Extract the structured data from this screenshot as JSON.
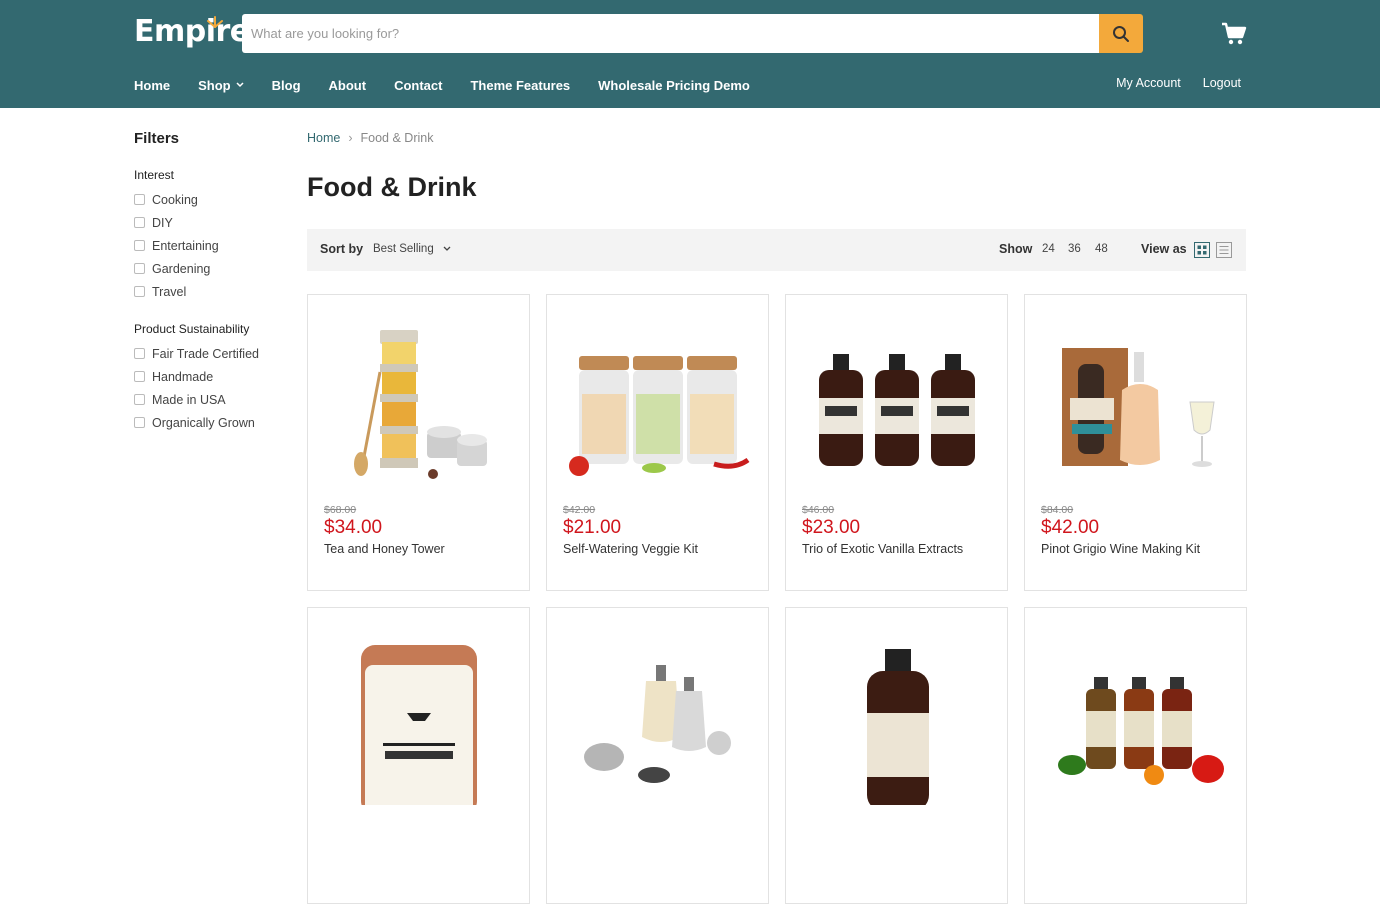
{
  "header": {
    "logo": "Empire",
    "search_placeholder": "What are you looking for?",
    "colors": {
      "bar": "#336970",
      "search_button": "#f3a93b",
      "price": "#d0161d"
    }
  },
  "nav": {
    "items": [
      "Home",
      "Shop",
      "Blog",
      "About",
      "Contact",
      "Theme Features",
      "Wholesale Pricing Demo"
    ],
    "account": [
      "My Account",
      "Logout"
    ]
  },
  "sidebar": {
    "title": "Filters",
    "groups": [
      {
        "title": "Interest",
        "options": [
          "Cooking",
          "DIY",
          "Entertaining",
          "Gardening",
          "Travel"
        ]
      },
      {
        "title": "Product Sustainability",
        "options": [
          "Fair Trade Certified",
          "Handmade",
          "Made in USA",
          "Organically Grown"
        ]
      }
    ]
  },
  "breadcrumb": {
    "home": "Home",
    "current": "Food & Drink"
  },
  "page_title": "Food & Drink",
  "toolbar": {
    "sort_label": "Sort by",
    "sort_value": "Best Selling",
    "show_label": "Show",
    "show_options": [
      "24",
      "36",
      "48"
    ],
    "view_label": "View as"
  },
  "products": [
    {
      "name": "Tea and Honey Tower",
      "old_price": "$68.00",
      "price": "$34.00",
      "image": "honey-jars-tower"
    },
    {
      "name": "Self-Watering Veggie Kit",
      "old_price": "$42.00",
      "price": "$21.00",
      "image": "veggie-seed-jars"
    },
    {
      "name": "Trio of Exotic Vanilla Extracts",
      "old_price": "$46.00",
      "price": "$23.00",
      "image": "vanilla-bottles"
    },
    {
      "name": "Pinot Grigio Wine Making Kit",
      "old_price": "$84.00",
      "price": "$42.00",
      "image": "wine-kit"
    },
    {
      "name": "",
      "image": "cocktail-kit-tin"
    },
    {
      "name": "",
      "image": "infusion-bottles-kit"
    },
    {
      "name": "",
      "image": "amber-bottle"
    },
    {
      "name": "",
      "image": "hot-sauce-bottles"
    }
  ]
}
